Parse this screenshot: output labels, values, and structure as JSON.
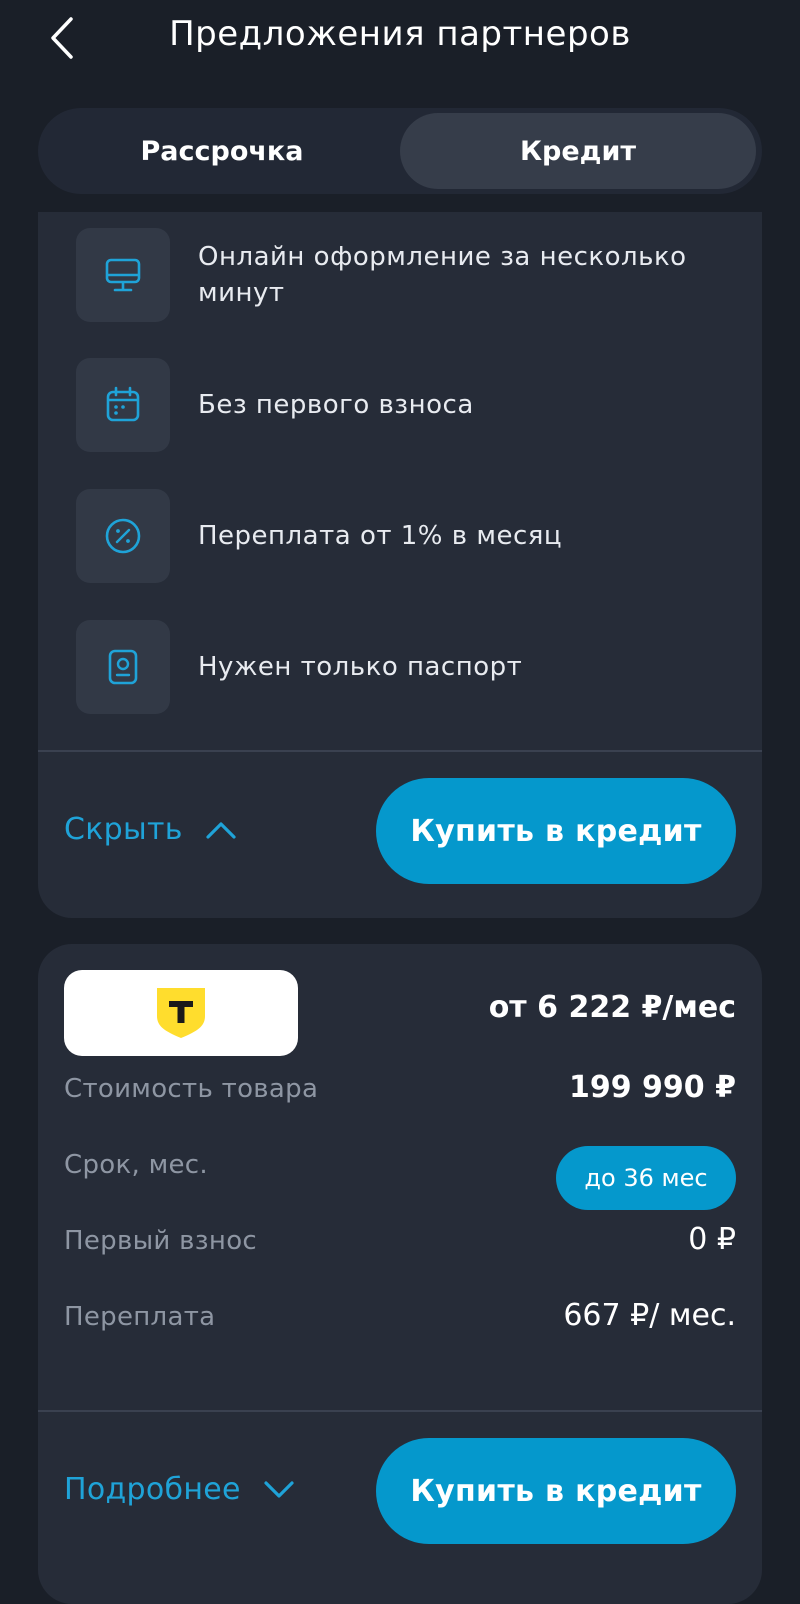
{
  "header": {
    "title": "Предложения партнеров",
    "back_icon": "chevron-left-icon"
  },
  "tabs": [
    {
      "label": "Рассрочка",
      "active": false
    },
    {
      "label": "Кредит",
      "active": true
    }
  ],
  "features": [
    {
      "icon": "monitor-icon",
      "text": "Онлайн оформление за несколько минут"
    },
    {
      "icon": "calendar-icon",
      "text": "Без первого взноса"
    },
    {
      "icon": "percent-icon",
      "text": "Переплата от 1% в месяц"
    },
    {
      "icon": "passport-icon",
      "text": "Нужен только паспорт"
    }
  ],
  "card1": {
    "toggle_label": "Скрыть",
    "toggle_icon": "chevron-up-icon",
    "buy_label": "Купить в кредит"
  },
  "card2": {
    "partner_logo": "tbank-logo",
    "monthly_payment": "от 6 222 ₽/мес",
    "rows": [
      {
        "label": "Стоимость товара",
        "value": "199 990 ₽"
      },
      {
        "label": "Срок, мес.",
        "value": "до 36 мес"
      },
      {
        "label": "Первый взнос",
        "value": "0 ₽"
      },
      {
        "label": "Переплата",
        "value": "667 ₽/ мес."
      }
    ],
    "toggle_label": "Подробнее",
    "toggle_icon": "chevron-down-icon",
    "buy_label": "Купить в кредит"
  },
  "colors": {
    "background": "#1a1f28",
    "card": "#262c38",
    "accent": "#0598cc",
    "link": "#1fa3d8",
    "muted_text": "#8e96a3",
    "logo_yellow": "#ffdd2d"
  }
}
